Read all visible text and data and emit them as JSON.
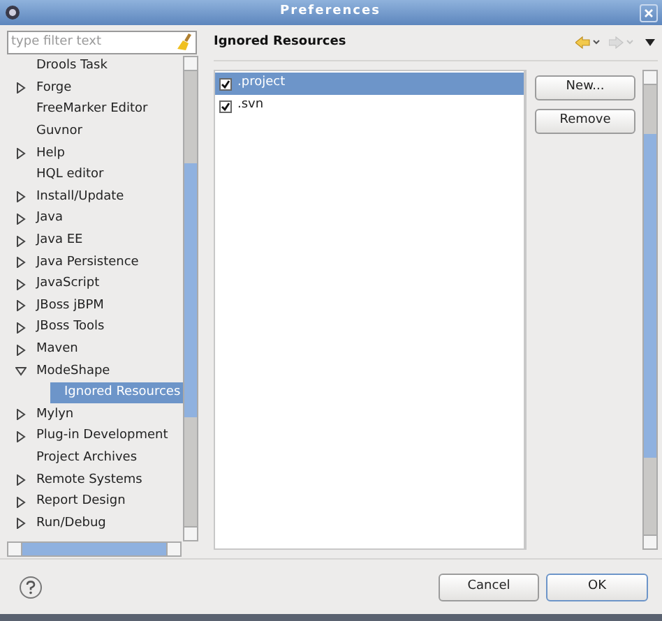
{
  "window": {
    "title": "Preferences"
  },
  "filter": {
    "placeholder": "type filter text"
  },
  "tree": [
    {
      "label": "Drools Task",
      "kind": "leaf",
      "selected": false
    },
    {
      "label": "Forge",
      "kind": "folder",
      "expanded": false,
      "selected": false
    },
    {
      "label": "FreeMarker Editor",
      "kind": "leaf",
      "selected": false
    },
    {
      "label": "Guvnor",
      "kind": "leaf",
      "selected": false
    },
    {
      "label": "Help",
      "kind": "folder",
      "expanded": false,
      "selected": false
    },
    {
      "label": "HQL editor",
      "kind": "leaf",
      "selected": false
    },
    {
      "label": "Install/Update",
      "kind": "folder",
      "expanded": false,
      "selected": false
    },
    {
      "label": "Java",
      "kind": "folder",
      "expanded": false,
      "selected": false
    },
    {
      "label": "Java EE",
      "kind": "folder",
      "expanded": false,
      "selected": false
    },
    {
      "label": "Java Persistence",
      "kind": "folder",
      "expanded": false,
      "selected": false
    },
    {
      "label": "JavaScript",
      "kind": "folder",
      "expanded": false,
      "selected": false
    },
    {
      "label": "JBoss jBPM",
      "kind": "folder",
      "expanded": false,
      "selected": false
    },
    {
      "label": "JBoss Tools",
      "kind": "folder",
      "expanded": false,
      "selected": false
    },
    {
      "label": "Maven",
      "kind": "folder",
      "expanded": false,
      "selected": false
    },
    {
      "label": "ModeShape",
      "kind": "folder",
      "expanded": true,
      "selected": false,
      "children": [
        {
          "label": "Ignored Resources",
          "kind": "leaf",
          "selected": true
        }
      ]
    },
    {
      "label": "Mylyn",
      "kind": "folder",
      "expanded": false,
      "selected": false
    },
    {
      "label": "Plug-in Development",
      "kind": "folder",
      "expanded": false,
      "selected": false
    },
    {
      "label": "Project Archives",
      "kind": "leaf",
      "selected": false
    },
    {
      "label": "Remote Systems",
      "kind": "folder",
      "expanded": false,
      "selected": false
    },
    {
      "label": "Report Design",
      "kind": "folder",
      "expanded": false,
      "selected": false
    },
    {
      "label": "Run/Debug",
      "kind": "folder",
      "expanded": false,
      "selected": false
    }
  ],
  "page": {
    "title": "Ignored Resources"
  },
  "resources": [
    {
      "label": ".project",
      "checked": true,
      "selected": true
    },
    {
      "label": ".svn",
      "checked": true,
      "selected": false
    }
  ],
  "side_buttons": [
    "New...",
    "Remove"
  ],
  "footer_buttons": [
    {
      "label": "Cancel",
      "default": false
    },
    {
      "label": "OK",
      "default": true
    }
  ]
}
